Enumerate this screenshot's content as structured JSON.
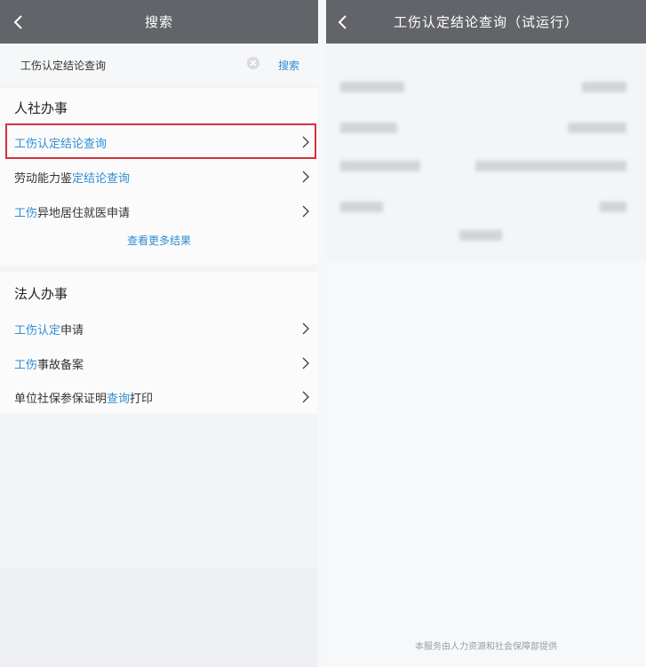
{
  "left": {
    "navbar": {
      "title": "搜索"
    },
    "search": {
      "value": "工伤认定结论查询",
      "button": "搜索"
    },
    "section1": {
      "title": "人社办事",
      "items": [
        {
          "prefix": "工伤认定结论查询",
          "suffix": "",
          "prefix_highlight": true
        },
        {
          "prefix": "劳动能力鉴",
          "highlight": "定结论查询",
          "suffix": ""
        },
        {
          "prefix": "",
          "highlight": "工伤",
          "suffix": "异地居住就医申请"
        }
      ],
      "more": "查看更多结果"
    },
    "section2": {
      "title": "法人办事",
      "items": [
        {
          "prefix": "",
          "highlight": "工伤认定",
          "suffix": "申请"
        },
        {
          "prefix": "",
          "highlight": "工伤",
          "suffix": "事故备案"
        },
        {
          "prefix": "单位社保参保证明",
          "highlight": "查询",
          "suffix": "打印"
        }
      ]
    }
  },
  "right": {
    "navbar": {
      "title": "工伤认定结论查询（试运行）"
    },
    "footer": "本服务由人力资源和社会保障部提供"
  },
  "colors": {
    "navbar": "#626469",
    "accent": "#2f8ed3",
    "highlight_border": "#d6303b"
  },
  "icons": {
    "back": "chevron-left-icon",
    "row": "chevron-right-icon",
    "clear": "clear-icon"
  }
}
